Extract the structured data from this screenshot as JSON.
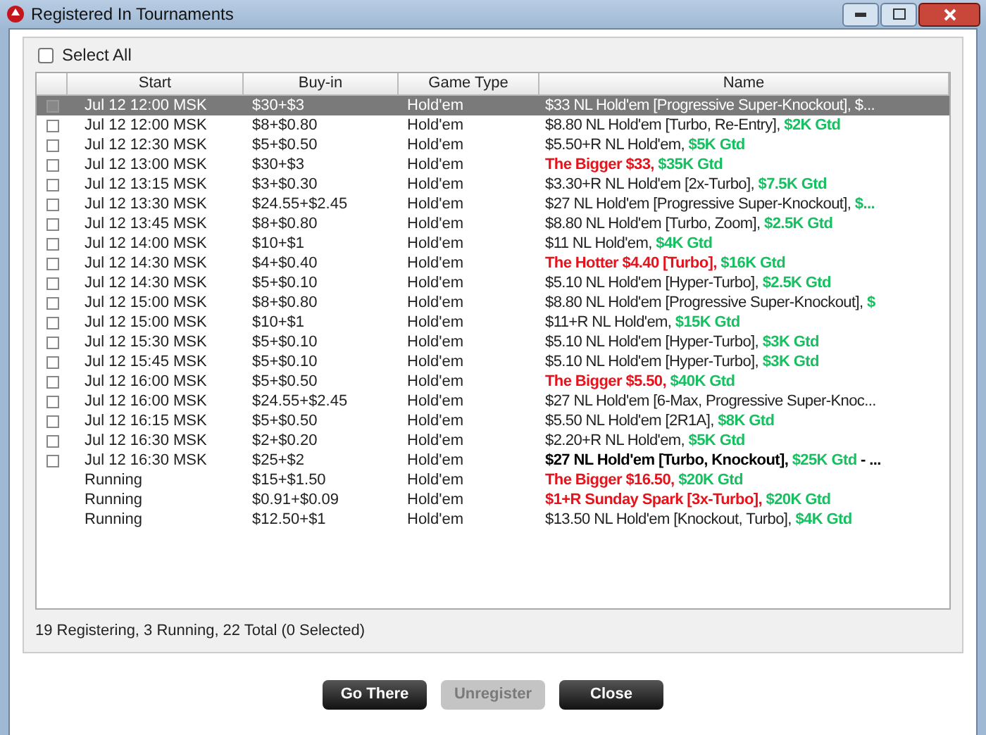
{
  "window": {
    "title": "Registered In Tournaments"
  },
  "select_all": {
    "label": "Select All",
    "checked": false
  },
  "table": {
    "columns": [
      "Start",
      "Buy-in",
      "Game Type",
      "Name"
    ],
    "rows": [
      {
        "checked": false,
        "selected": true,
        "start": "Jul 12  12:00 MSK",
        "buyin": "$30+$3",
        "game": "Hold'em",
        "name": [
          {
            "kind": "plain",
            "text": "$33 NL Hold'em [Progressive Super-Knockout], $..."
          }
        ]
      },
      {
        "checked": false,
        "selected": false,
        "start": "Jul 12  12:00 MSK",
        "buyin": "$8+$0.80",
        "game": "Hold'em",
        "name": [
          {
            "kind": "plain",
            "text": "$8.80 NL Hold'em [Turbo, Re-Entry], "
          },
          {
            "kind": "green",
            "text": "$2K Gtd"
          }
        ]
      },
      {
        "checked": false,
        "selected": false,
        "start": "Jul 12  12:30 MSK",
        "buyin": "$5+$0.50",
        "game": "Hold'em",
        "name": [
          {
            "kind": "plain",
            "text": "$5.50+R NL Hold'em, "
          },
          {
            "kind": "green",
            "text": "$5K Gtd"
          }
        ]
      },
      {
        "checked": false,
        "selected": false,
        "start": "Jul 12  13:00 MSK",
        "buyin": "$30+$3",
        "game": "Hold'em",
        "name": [
          {
            "kind": "red",
            "text": "The Bigger $33, "
          },
          {
            "kind": "green",
            "text": "$35K Gtd"
          }
        ]
      },
      {
        "checked": false,
        "selected": false,
        "start": "Jul 12  13:15 MSK",
        "buyin": "$3+$0.30",
        "game": "Hold'em",
        "name": [
          {
            "kind": "plain",
            "text": "$3.30+R NL Hold'em [2x-Turbo], "
          },
          {
            "kind": "green",
            "text": "$7.5K Gtd"
          }
        ]
      },
      {
        "checked": false,
        "selected": false,
        "start": "Jul 12  13:30 MSK",
        "buyin": "$24.55+$2.45",
        "game": "Hold'em",
        "name": [
          {
            "kind": "plain",
            "text": "$27 NL Hold'em [Progressive Super-Knockout], "
          },
          {
            "kind": "green",
            "text": "$..."
          }
        ]
      },
      {
        "checked": false,
        "selected": false,
        "start": "Jul 12  13:45 MSK",
        "buyin": "$8+$0.80",
        "game": "Hold'em",
        "name": [
          {
            "kind": "plain",
            "text": "$8.80 NL Hold'em [Turbo, Zoom], "
          },
          {
            "kind": "green",
            "text": "$2.5K Gtd"
          }
        ]
      },
      {
        "checked": false,
        "selected": false,
        "start": "Jul 12  14:00 MSK",
        "buyin": "$10+$1",
        "game": "Hold'em",
        "name": [
          {
            "kind": "plain",
            "text": "$11 NL Hold'em, "
          },
          {
            "kind": "green",
            "text": "$4K Gtd"
          }
        ]
      },
      {
        "checked": false,
        "selected": false,
        "start": "Jul 12  14:30 MSK",
        "buyin": "$4+$0.40",
        "game": "Hold'em",
        "name": [
          {
            "kind": "red",
            "text": "The Hotter $4.40 [Turbo], "
          },
          {
            "kind": "green",
            "text": "$16K Gtd"
          }
        ]
      },
      {
        "checked": false,
        "selected": false,
        "start": "Jul 12  14:30 MSK",
        "buyin": "$5+$0.10",
        "game": "Hold'em",
        "name": [
          {
            "kind": "plain",
            "text": "$5.10 NL Hold'em [Hyper-Turbo], "
          },
          {
            "kind": "green",
            "text": "$2.5K Gtd"
          }
        ]
      },
      {
        "checked": false,
        "selected": false,
        "start": "Jul 12  15:00 MSK",
        "buyin": "$8+$0.80",
        "game": "Hold'em",
        "name": [
          {
            "kind": "plain",
            "text": "$8.80 NL Hold'em [Progressive Super-Knockout], "
          },
          {
            "kind": "green",
            "text": "$"
          }
        ]
      },
      {
        "checked": false,
        "selected": false,
        "start": "Jul 12  15:00 MSK",
        "buyin": "$10+$1",
        "game": "Hold'em",
        "name": [
          {
            "kind": "plain",
            "text": "$11+R NL Hold'em, "
          },
          {
            "kind": "green",
            "text": "$15K Gtd"
          }
        ]
      },
      {
        "checked": false,
        "selected": false,
        "start": "Jul 12  15:30 MSK",
        "buyin": "$5+$0.10",
        "game": "Hold'em",
        "name": [
          {
            "kind": "plain",
            "text": "$5.10 NL Hold'em [Hyper-Turbo], "
          },
          {
            "kind": "green",
            "text": "$3K Gtd"
          }
        ]
      },
      {
        "checked": false,
        "selected": false,
        "start": "Jul 12  15:45 MSK",
        "buyin": "$5+$0.10",
        "game": "Hold'em",
        "name": [
          {
            "kind": "plain",
            "text": "$5.10 NL Hold'em [Hyper-Turbo], "
          },
          {
            "kind": "green",
            "text": "$3K Gtd"
          }
        ]
      },
      {
        "checked": false,
        "selected": false,
        "start": "Jul 12  16:00 MSK",
        "buyin": "$5+$0.50",
        "game": "Hold'em",
        "name": [
          {
            "kind": "red",
            "text": "The Bigger $5.50, "
          },
          {
            "kind": "green",
            "text": "$40K Gtd"
          }
        ]
      },
      {
        "checked": false,
        "selected": false,
        "start": "Jul 12  16:00 MSK",
        "buyin": "$24.55+$2.45",
        "game": "Hold'em",
        "name": [
          {
            "kind": "plain",
            "text": "$27 NL Hold'em [6-Max, Progressive Super-Knoc..."
          }
        ]
      },
      {
        "checked": false,
        "selected": false,
        "start": "Jul 12  16:15 MSK",
        "buyin": "$5+$0.50",
        "game": "Hold'em",
        "name": [
          {
            "kind": "plain",
            "text": "$5.50 NL Hold'em [2R1A], "
          },
          {
            "kind": "green",
            "text": "$8K Gtd"
          }
        ]
      },
      {
        "checked": false,
        "selected": false,
        "start": "Jul 12  16:30 MSK",
        "buyin": "$2+$0.20",
        "game": "Hold'em",
        "name": [
          {
            "kind": "plain",
            "text": "$2.20+R NL Hold'em, "
          },
          {
            "kind": "green",
            "text": "$5K Gtd"
          }
        ]
      },
      {
        "checked": false,
        "selected": false,
        "start": "Jul 12  16:30 MSK",
        "buyin": "$25+$2",
        "game": "Hold'em",
        "name": [
          {
            "kind": "bold",
            "text": "$27 NL Hold'em [Turbo, Knockout], "
          },
          {
            "kind": "green",
            "text": "$25K Gtd"
          },
          {
            "kind": "bold",
            "text": " - ..."
          }
        ]
      },
      {
        "selected": false,
        "start": "Running",
        "buyin": "$15+$1.50",
        "game": "Hold'em",
        "name": [
          {
            "kind": "red",
            "text": "The Bigger $16.50, "
          },
          {
            "kind": "green",
            "text": "$20K Gtd"
          }
        ]
      },
      {
        "selected": false,
        "start": "Running",
        "buyin": "$0.91+$0.09",
        "game": "Hold'em",
        "name": [
          {
            "kind": "red",
            "text": "$1+R Sunday Spark [3x-Turbo], "
          },
          {
            "kind": "green",
            "text": "$20K Gtd"
          }
        ]
      },
      {
        "selected": false,
        "start": "Running",
        "buyin": "$12.50+$1",
        "game": "Hold'em",
        "name": [
          {
            "kind": "plain",
            "text": "$13.50 NL Hold'em [Knockout, Turbo], "
          },
          {
            "kind": "green",
            "text": "$4K Gtd"
          }
        ]
      }
    ]
  },
  "status": "19 Registering, 3 Running, 22 Total (0 Selected)",
  "buttons": [
    {
      "label": "Go There",
      "disabled": false
    },
    {
      "label": "Unregister",
      "disabled": true
    },
    {
      "label": "Close",
      "disabled": false
    }
  ]
}
